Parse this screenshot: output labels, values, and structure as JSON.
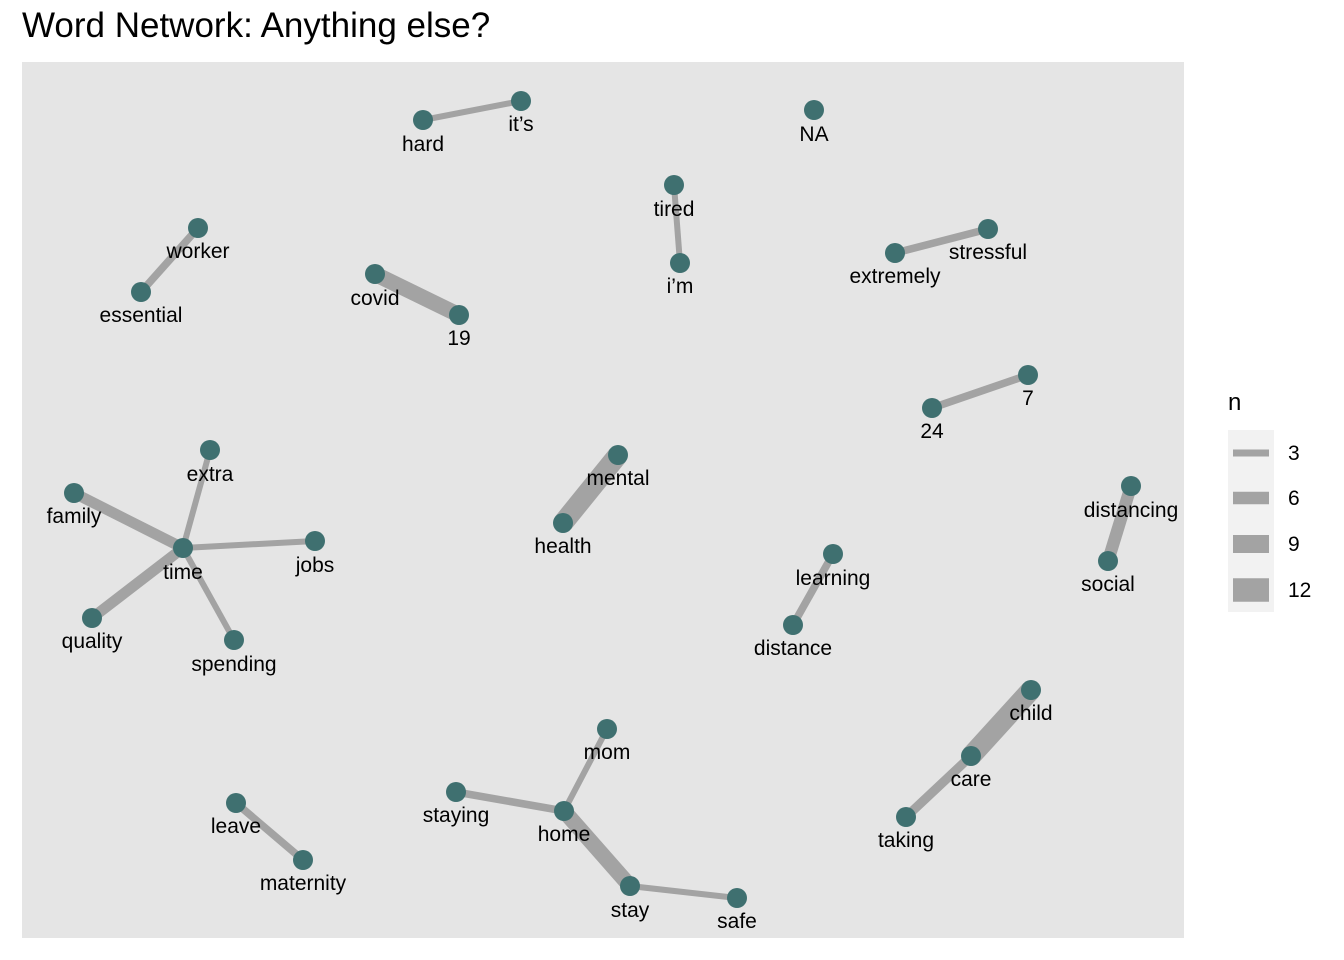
{
  "chart_data": {
    "type": "network",
    "title": "Word Network: Anything else?",
    "legend": {
      "title": "n",
      "placement": "right",
      "entries": [
        {
          "label": "3",
          "value": 3
        },
        {
          "label": "6",
          "value": 6
        },
        {
          "label": "9",
          "value": 9
        },
        {
          "label": "12",
          "value": 12
        }
      ]
    },
    "nodes": [
      {
        "id": "hard",
        "label": "hard"
      },
      {
        "id": "its",
        "label": "it’s"
      },
      {
        "id": "na",
        "label": "NA"
      },
      {
        "id": "tired",
        "label": "tired"
      },
      {
        "id": "im",
        "label": "i’m"
      },
      {
        "id": "worker",
        "label": "worker"
      },
      {
        "id": "essential",
        "label": "essential"
      },
      {
        "id": "covid",
        "label": "covid"
      },
      {
        "id": "n19",
        "label": "19"
      },
      {
        "id": "stressful",
        "label": "stressful"
      },
      {
        "id": "extremely",
        "label": "extremely"
      },
      {
        "id": "n7",
        "label": "7"
      },
      {
        "id": "n24",
        "label": "24"
      },
      {
        "id": "extra",
        "label": "extra"
      },
      {
        "id": "family",
        "label": "family"
      },
      {
        "id": "time",
        "label": "time"
      },
      {
        "id": "jobs",
        "label": "jobs"
      },
      {
        "id": "quality",
        "label": "quality"
      },
      {
        "id": "spending",
        "label": "spending"
      },
      {
        "id": "mental",
        "label": "mental"
      },
      {
        "id": "health",
        "label": "health"
      },
      {
        "id": "learning",
        "label": "learning"
      },
      {
        "id": "distance",
        "label": "distance"
      },
      {
        "id": "distancing",
        "label": "distancing"
      },
      {
        "id": "social",
        "label": "social"
      },
      {
        "id": "child",
        "label": "child"
      },
      {
        "id": "care",
        "label": "care"
      },
      {
        "id": "taking",
        "label": "taking"
      },
      {
        "id": "mom",
        "label": "mom"
      },
      {
        "id": "staying",
        "label": "staying"
      },
      {
        "id": "home",
        "label": "home"
      },
      {
        "id": "stay",
        "label": "stay"
      },
      {
        "id": "safe",
        "label": "safe"
      },
      {
        "id": "leave",
        "label": "leave"
      },
      {
        "id": "maternity",
        "label": "maternity"
      }
    ],
    "edges": [
      {
        "source": "hard",
        "target": "its",
        "n": 3
      },
      {
        "source": "tired",
        "target": "im",
        "n": 3
      },
      {
        "source": "essential",
        "target": "worker",
        "n": 4
      },
      {
        "source": "covid",
        "target": "n19",
        "n": 9
      },
      {
        "source": "extremely",
        "target": "stressful",
        "n": 4
      },
      {
        "source": "n24",
        "target": "n7",
        "n": 4
      },
      {
        "source": "family",
        "target": "time",
        "n": 6
      },
      {
        "source": "extra",
        "target": "time",
        "n": 3
      },
      {
        "source": "time",
        "target": "jobs",
        "n": 3
      },
      {
        "source": "quality",
        "target": "time",
        "n": 6
      },
      {
        "source": "spending",
        "target": "time",
        "n": 3
      },
      {
        "source": "mental",
        "target": "health",
        "n": 12
      },
      {
        "source": "distance",
        "target": "learning",
        "n": 4
      },
      {
        "source": "social",
        "target": "distancing",
        "n": 7
      },
      {
        "source": "child",
        "target": "care",
        "n": 12
      },
      {
        "source": "taking",
        "target": "care",
        "n": 5
      },
      {
        "source": "staying",
        "target": "home",
        "n": 4
      },
      {
        "source": "home",
        "target": "mom",
        "n": 3
      },
      {
        "source": "stay",
        "target": "home",
        "n": 9
      },
      {
        "source": "stay",
        "target": "safe",
        "n": 3
      },
      {
        "source": "leave",
        "target": "maternity",
        "n": 4
      }
    ]
  },
  "colors": {
    "panel": "#e5e5e5",
    "node": "#3f7070",
    "edge": "#a3a3a3",
    "text": "#000000"
  }
}
